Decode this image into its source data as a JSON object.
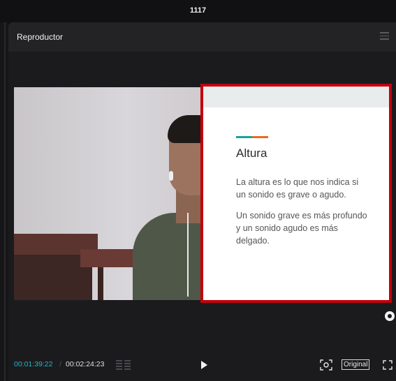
{
  "window": {
    "title": "1117"
  },
  "panel": {
    "title": "Reproductor"
  },
  "slide": {
    "title": "Altura",
    "paragraph1": "La altura es lo que nos indica si un sonido es grave o agudo.",
    "paragraph2": "Un sonido grave es más profundo y un sonido agudo es más delgado.",
    "accent_colors": [
      "#16a39a",
      "#ef6a1f"
    ],
    "highlight_border": "#c4000a"
  },
  "controls": {
    "current_time": "00:01:39:22",
    "total_time": "00:02:24:23",
    "zoom_label": "Original",
    "current_time_color": "#21b6c9"
  },
  "icons": [
    "menu-icon",
    "chapters-icon",
    "play-icon",
    "focus-icon",
    "fullscreen-icon",
    "record-indicator-icon"
  ]
}
